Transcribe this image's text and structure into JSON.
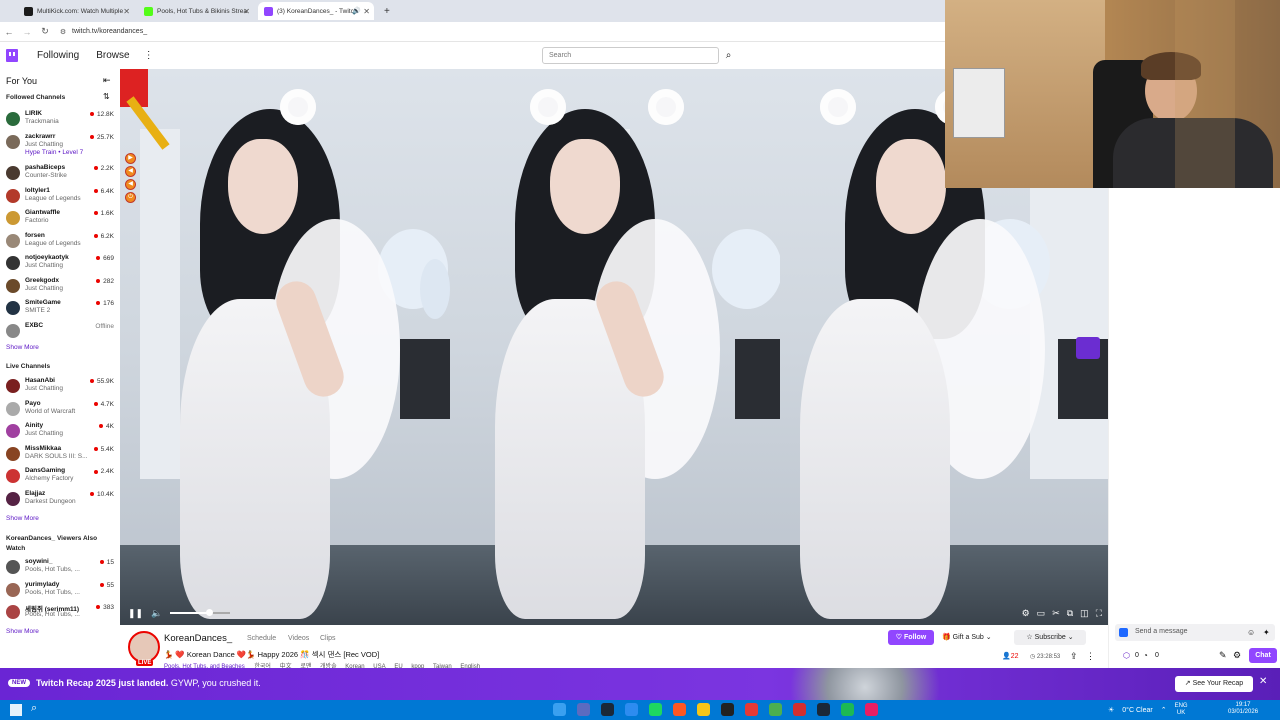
{
  "browser": {
    "tabs": [
      {
        "label": "MultiKick.com: Watch Multiple",
        "color": "#1b1b1b"
      },
      {
        "label": "Pools, Hot Tubs & Bikinis Strea",
        "color": "#53fc18"
      },
      {
        "label": "(3) KoreanDances_ - Twitch",
        "color": "#9146ff"
      }
    ],
    "new_tab": "+",
    "url": "twitch.tv/koreandances_"
  },
  "topnav": {
    "following": "Following",
    "browse": "Browse",
    "more": "⋮",
    "search_placeholder": "Search"
  },
  "sidebar": {
    "for_you": "For You",
    "followed_title": "Followed Channels",
    "followed": [
      {
        "name": "LIRIK",
        "game": "Trackmania",
        "viewers": "12.8K",
        "color": "#2a6b3c"
      },
      {
        "name": "zackrawrr",
        "game": "Just Chatting",
        "extra": "Hype Train • Level 7",
        "viewers": "25.7K",
        "color": "#7a6a5a"
      },
      {
        "name": "pashaBiceps",
        "game": "Counter-Strike",
        "viewers": "2.2K",
        "color": "#4a3a30"
      },
      {
        "name": "loltyler1",
        "game": "League of Legends",
        "viewers": "6.4K",
        "color": "#b33a2a"
      },
      {
        "name": "Giantwaffle",
        "game": "Factorio",
        "viewers": "1.6K",
        "color": "#cc9933"
      },
      {
        "name": "forsen",
        "game": "League of Legends",
        "viewers": "6.2K",
        "color": "#998877"
      },
      {
        "name": "notjoeykaotyk",
        "game": "Just Chatting",
        "viewers": "669",
        "color": "#333333"
      },
      {
        "name": "Greekgodx",
        "game": "Just Chatting",
        "viewers": "282",
        "color": "#6b4a2a"
      },
      {
        "name": "SmiteGame",
        "game": "SMITE 2",
        "viewers": "176",
        "color": "#223344"
      },
      {
        "name": "EXBC",
        "game": "",
        "viewers": "Offline",
        "color": "#888888"
      }
    ],
    "show_more_1": "Show More",
    "live_title": "Live Channels",
    "live": [
      {
        "name": "HasanAbi",
        "game": "Just Chatting",
        "viewers": "55.9K",
        "color": "#7a2020"
      },
      {
        "name": "Payo",
        "game": "World of Warcraft",
        "viewers": "4.7K",
        "color": "#aaaaaa"
      },
      {
        "name": "Ainity",
        "game": "Just Chatting",
        "viewers": "4K",
        "color": "#a040a0"
      },
      {
        "name": "MissMikkaa",
        "game": "DARK SOULS III: S...",
        "viewers": "5.4K",
        "color": "#884422"
      },
      {
        "name": "DansGaming",
        "game": "Alchemy Factory",
        "viewers": "2.4K",
        "color": "#cc3333"
      },
      {
        "name": "Elajjaz",
        "game": "Darkest Dungeon",
        "viewers": "10.4K",
        "color": "#552244"
      }
    ],
    "show_more_2": "Show More",
    "also_watch_title": "KoreanDances_ Viewers Also Watch",
    "also_watch": [
      {
        "name": "soywini_",
        "game": "Pools, Hot Tubs, ...",
        "viewers": "15",
        "color": "#555555"
      },
      {
        "name": "yurimylady",
        "game": "Pools, Hot Tubs, ...",
        "viewers": "55",
        "color": "#996655"
      },
      {
        "name": "세림쥐 (serimm11)",
        "game": "Pools, Hot Tubs, ...",
        "viewers": "383",
        "color": "#aa4444"
      }
    ],
    "show_more_3": "Show More"
  },
  "channel": {
    "name": "KoreanDances_",
    "tabs": [
      "Schedule",
      "Videos",
      "Clips"
    ],
    "live_badge": "LIVE",
    "title": "💃 ❤️ Korean Dance ❤️💃 Happy 2026 🎊 섹시 댄스 [Rec VOD]",
    "category": "Pools, Hot Tubs, and Beaches",
    "tags": [
      "한국어",
      "中文",
      "로맨",
      "개방솔",
      "Korean",
      "USA",
      "EU",
      "kpop",
      "Taiwan",
      "English"
    ],
    "follow": "Follow",
    "gift": "Gift a Sub",
    "subscribe": "Subscribe",
    "viewers": "22",
    "uptime": "23:28:53"
  },
  "chat": {
    "placeholder": "Send a message",
    "points": "0",
    "points2": "0",
    "chat_button": "Chat"
  },
  "banner": {
    "new": "NEW",
    "message": "Twitch Recap 2025 just landed.",
    "message2": "GYWP, you crushed it.",
    "button": "See Your Recap",
    "close": "✕"
  },
  "taskbar": {
    "temperature": "0°C  Clear",
    "lang": "ENG",
    "lang2": "UK",
    "time": "19:17",
    "date": "03/01/2026"
  }
}
